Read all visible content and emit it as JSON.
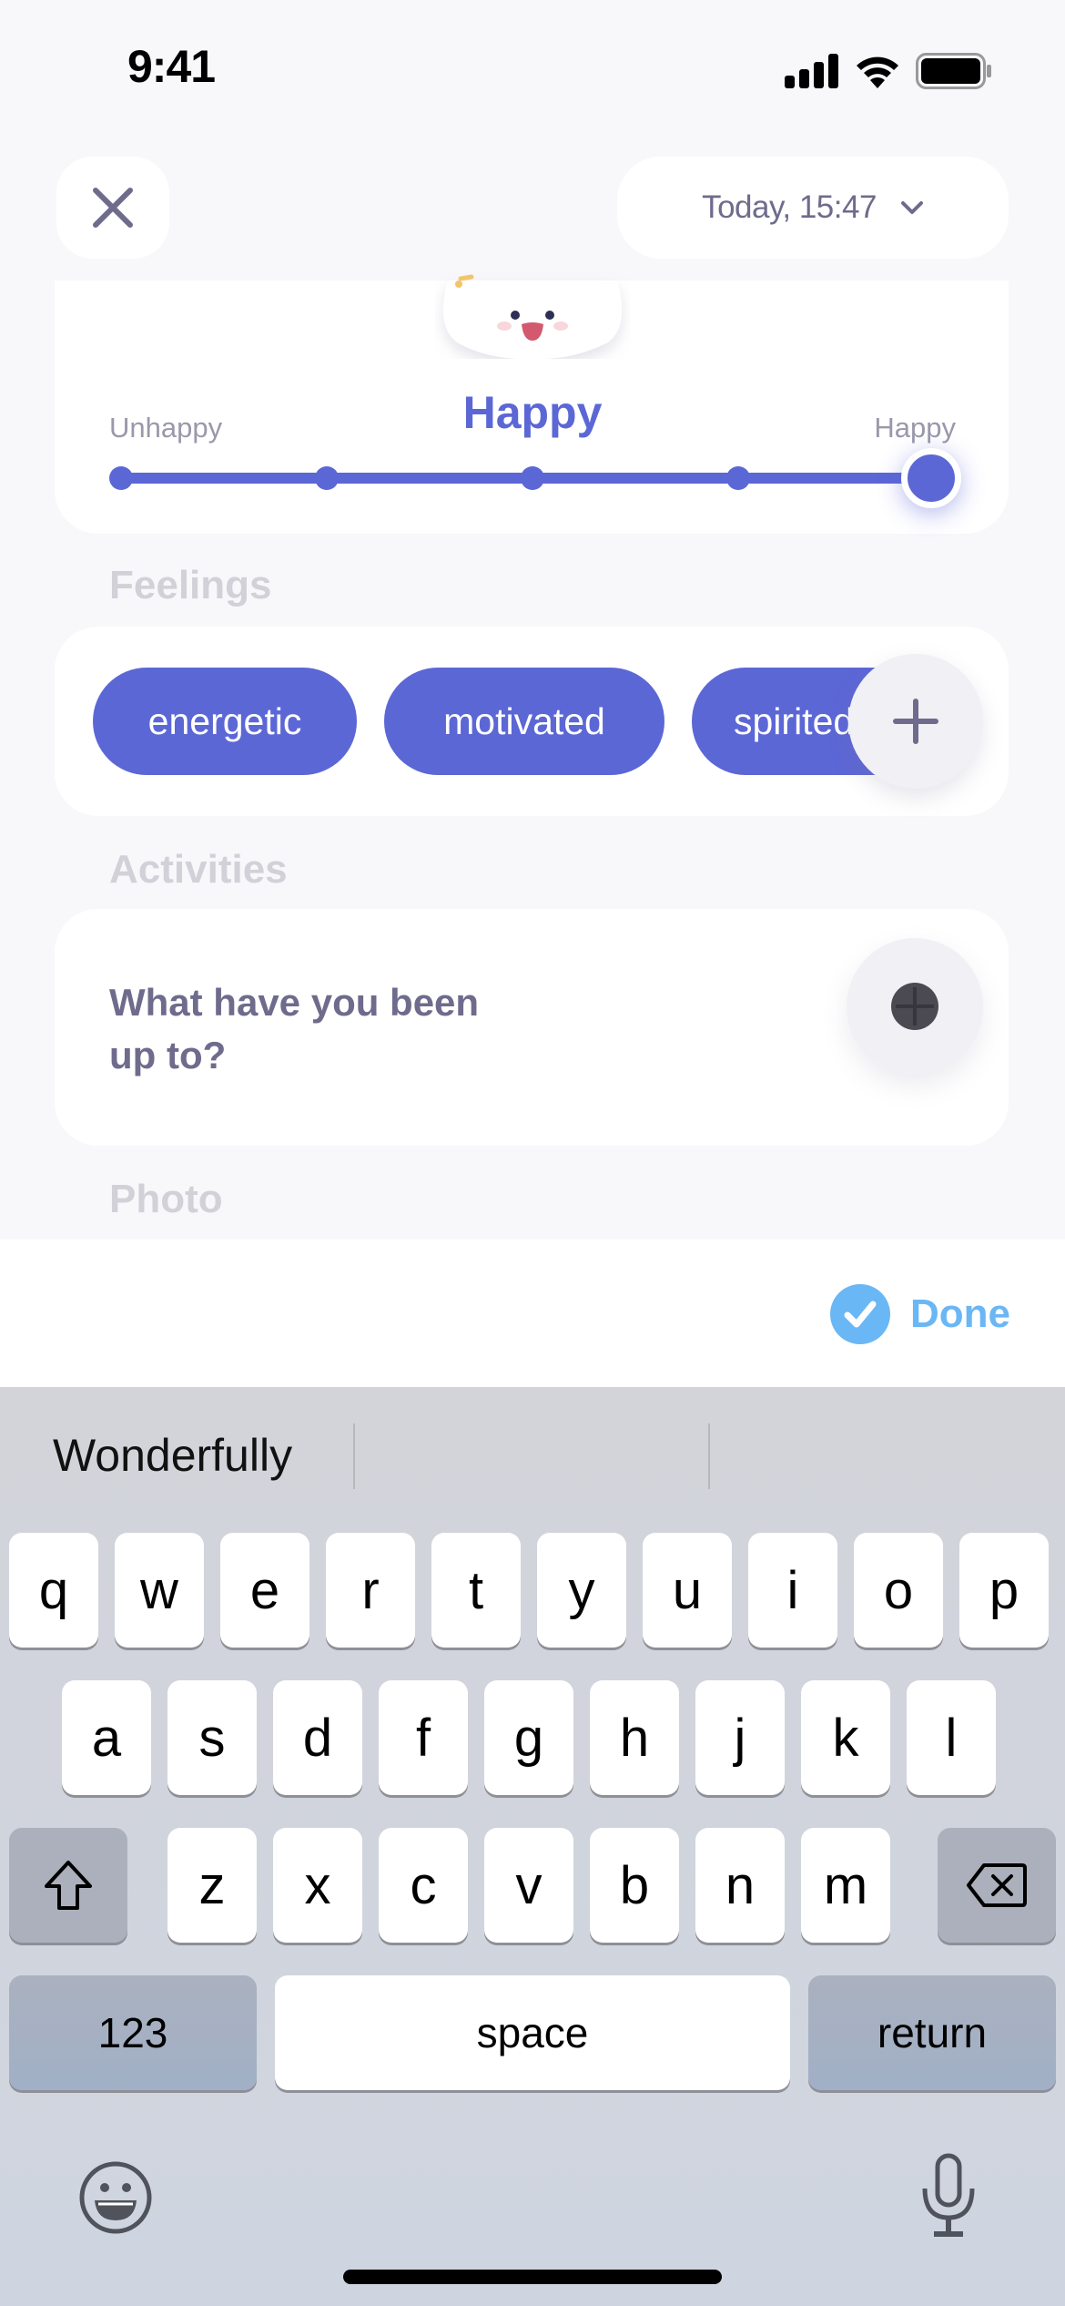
{
  "status_bar": {
    "time": "9:41",
    "icons": [
      "cellular-signal-icon",
      "wifi-icon",
      "battery-icon"
    ]
  },
  "header": {
    "close_icon": "close-icon",
    "date_label": "Today, 15:47",
    "date_icon": "chevron-down-icon"
  },
  "mood": {
    "title": "Happy",
    "left_label": "Unhappy",
    "right_label": "Happy",
    "steps": 5,
    "selected_step": 5,
    "accent_color": "#5c67d6"
  },
  "feelings": {
    "section_label": "Feelings",
    "chips": [
      {
        "label": "energetic"
      },
      {
        "label": "motivated"
      },
      {
        "label": "spirited"
      }
    ],
    "add_icon": "plus-icon"
  },
  "activities": {
    "section_label": "Activities",
    "prompt": "What have you been up to?",
    "add_icon": "plus-circle-icon"
  },
  "photo": {
    "section_label": "Photo"
  },
  "toolbar": {
    "done_label": "Done",
    "done_icon": "checkmark-circle-icon",
    "done_color": "#6ab7f5"
  },
  "keyboard": {
    "suggestions": [
      "Wonderfully",
      "",
      ""
    ],
    "rows": [
      [
        "q",
        "w",
        "e",
        "r",
        "t",
        "y",
        "u",
        "i",
        "o",
        "p"
      ],
      [
        "a",
        "s",
        "d",
        "f",
        "g",
        "h",
        "j",
        "k",
        "l"
      ],
      [
        "z",
        "x",
        "c",
        "v",
        "b",
        "n",
        "m"
      ]
    ],
    "shift_icon": "shift-icon",
    "delete_icon": "delete-icon",
    "numbers_label": "123",
    "space_label": "space",
    "return_label": "return",
    "emoji_icon": "emoji-icon",
    "mic_icon": "microphone-icon"
  }
}
